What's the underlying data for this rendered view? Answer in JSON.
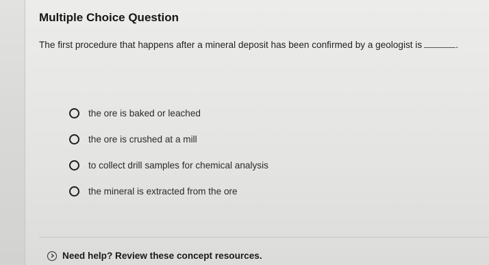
{
  "question": {
    "type_title": "Multiple Choice Question",
    "prompt": "The first procedure that happens after a mineral deposit has been confirmed by a geologist is",
    "prompt_end": "."
  },
  "options": [
    {
      "label": "the ore is baked or leached",
      "selected": false
    },
    {
      "label": "the ore is crushed at a mill",
      "selected": false
    },
    {
      "label": "to collect drill samples for chemical analysis",
      "selected": false
    },
    {
      "label": "the mineral is extracted from the ore",
      "selected": false
    }
  ],
  "help": {
    "label": "Need help? Review these concept resources.",
    "icon": "chevron-circle-icon"
  }
}
